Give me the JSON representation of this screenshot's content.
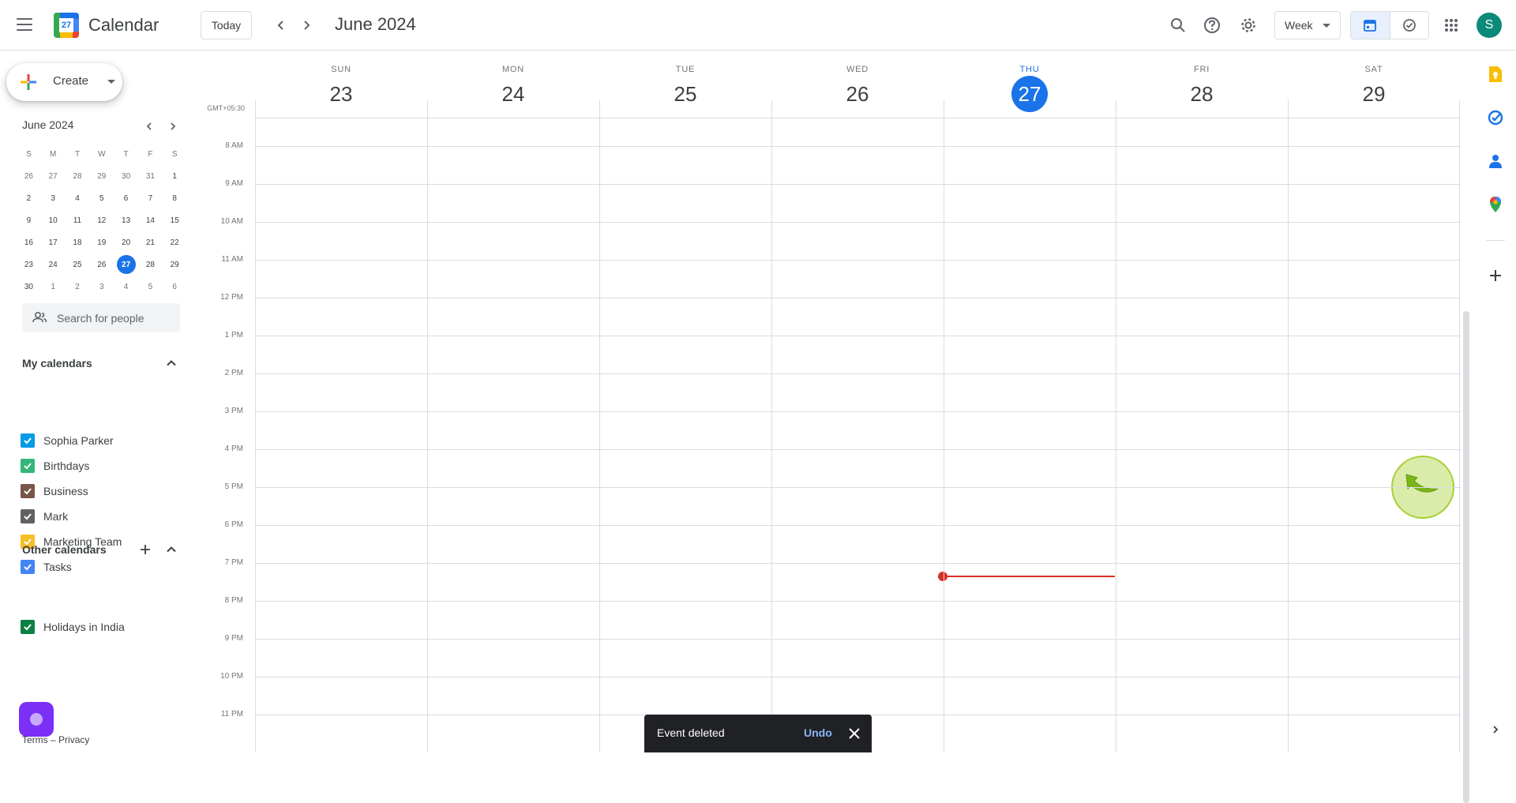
{
  "header": {
    "app_title": "Calendar",
    "logo_day": "27",
    "today_label": "Today",
    "month_title": "June 2024",
    "view_label": "Week",
    "avatar_initial": "S"
  },
  "sidebar": {
    "create_label": "Create",
    "mini_calendar": {
      "title": "June 2024",
      "dow": [
        "S",
        "M",
        "T",
        "W",
        "T",
        "F",
        "S"
      ],
      "weeks": [
        [
          "26",
          "27",
          "28",
          "29",
          "30",
          "31",
          "1"
        ],
        [
          "2",
          "3",
          "4",
          "5",
          "6",
          "7",
          "8"
        ],
        [
          "9",
          "10",
          "11",
          "12",
          "13",
          "14",
          "15"
        ],
        [
          "16",
          "17",
          "18",
          "19",
          "20",
          "21",
          "22"
        ],
        [
          "23",
          "24",
          "25",
          "26",
          "27",
          "28",
          "29"
        ],
        [
          "30",
          "1",
          "2",
          "3",
          "4",
          "5",
          "6"
        ]
      ],
      "today": "27"
    },
    "search_placeholder": "Search for people",
    "my_calendars_title": "My calendars",
    "my_calendars": [
      {
        "name": "Sophia Parker",
        "color": "#039be5"
      },
      {
        "name": "Birthdays",
        "color": "#33b679"
      },
      {
        "name": "Business",
        "color": "#795548"
      },
      {
        "name": "Mark",
        "color": "#616161"
      },
      {
        "name": "Marketing Team",
        "color": "#f6bf26"
      },
      {
        "name": "Tasks",
        "color": "#4285f4"
      }
    ],
    "other_calendars_title": "Other calendars",
    "other_calendars": [
      {
        "name": "Holidays in India",
        "color": "#0b8043"
      }
    ],
    "footer": {
      "terms": "Terms",
      "separator": "–",
      "privacy": "Privacy"
    }
  },
  "week": {
    "timezone": "GMT+05:30",
    "days": [
      {
        "dow": "SUN",
        "date": "23"
      },
      {
        "dow": "MON",
        "date": "24"
      },
      {
        "dow": "TUE",
        "date": "25"
      },
      {
        "dow": "WED",
        "date": "26"
      },
      {
        "dow": "THU",
        "date": "27",
        "today": true
      },
      {
        "dow": "FRI",
        "date": "28"
      },
      {
        "dow": "SAT",
        "date": "29"
      }
    ],
    "hours": [
      "8 AM",
      "9 AM",
      "10 AM",
      "11 AM",
      "12 PM",
      "1 PM",
      "2 PM",
      "3 PM",
      "4 PM",
      "5 PM",
      "6 PM",
      "7 PM",
      "8 PM",
      "9 PM",
      "10 PM",
      "11 PM"
    ]
  },
  "snackbar": {
    "message": "Event deleted",
    "undo_label": "Undo"
  },
  "colors": {
    "accent": "#1a73e8",
    "now_line": "#d93025"
  }
}
